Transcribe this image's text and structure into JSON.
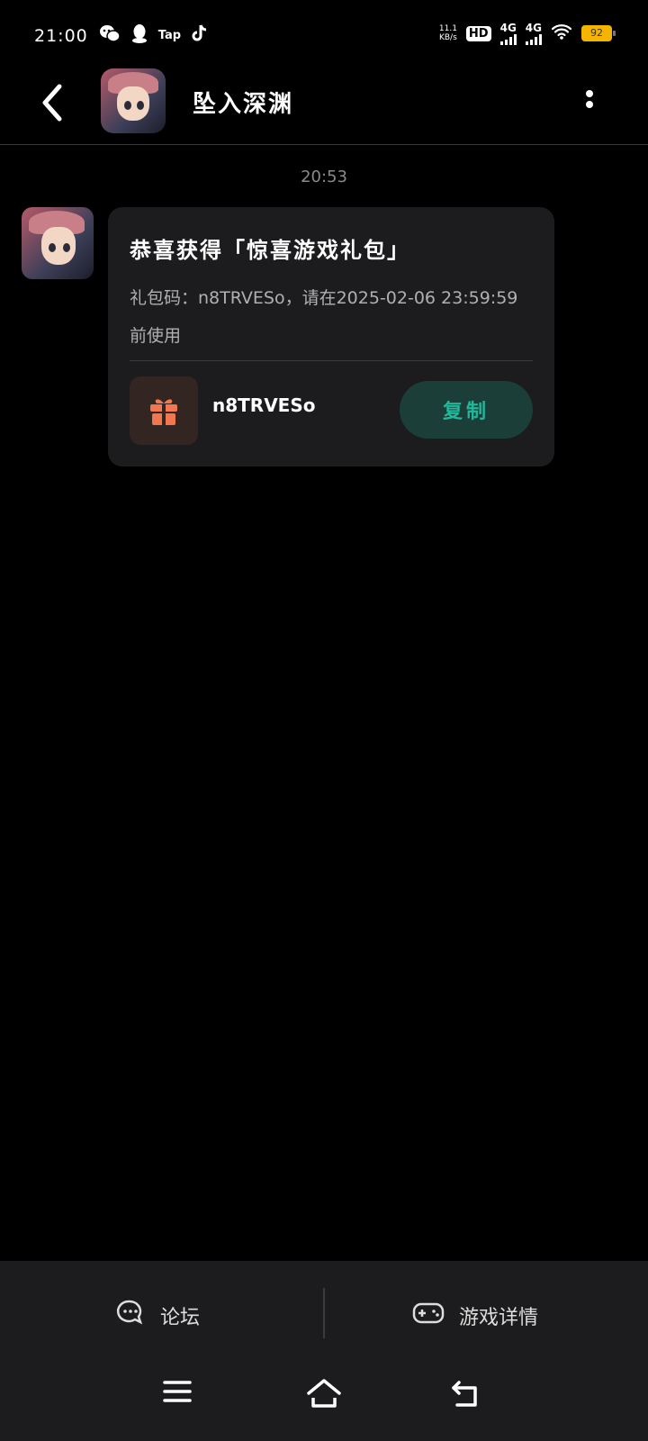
{
  "status_bar": {
    "time": "21:00",
    "net_speed": "11.1",
    "net_unit": "KB/s",
    "hd_label": "HD",
    "signal1_label": "4G",
    "signal2_label": "4G",
    "battery": "92",
    "battery_color": "#f4b400",
    "tap_label": "Tap",
    "left_icons": [
      "wechat-icon",
      "qq-icon",
      "taptap-icon",
      "tiktok-icon"
    ]
  },
  "header": {
    "title": "坠入深渊"
  },
  "chat": {
    "timestamp": "20:53",
    "card": {
      "title": "恭喜获得「惊喜游戏礼包」",
      "body": "礼包码：n8TRVESo，请在2025-02-06 23:59:59前使用",
      "code": "n8TRVESo",
      "copy_label": "复制",
      "gift_icon": "gift-icon",
      "accent_color": "#22b79a",
      "gift_color": "#f2774e"
    }
  },
  "bottom": {
    "forum_label": "论坛",
    "game_detail_label": "游戏详情"
  }
}
